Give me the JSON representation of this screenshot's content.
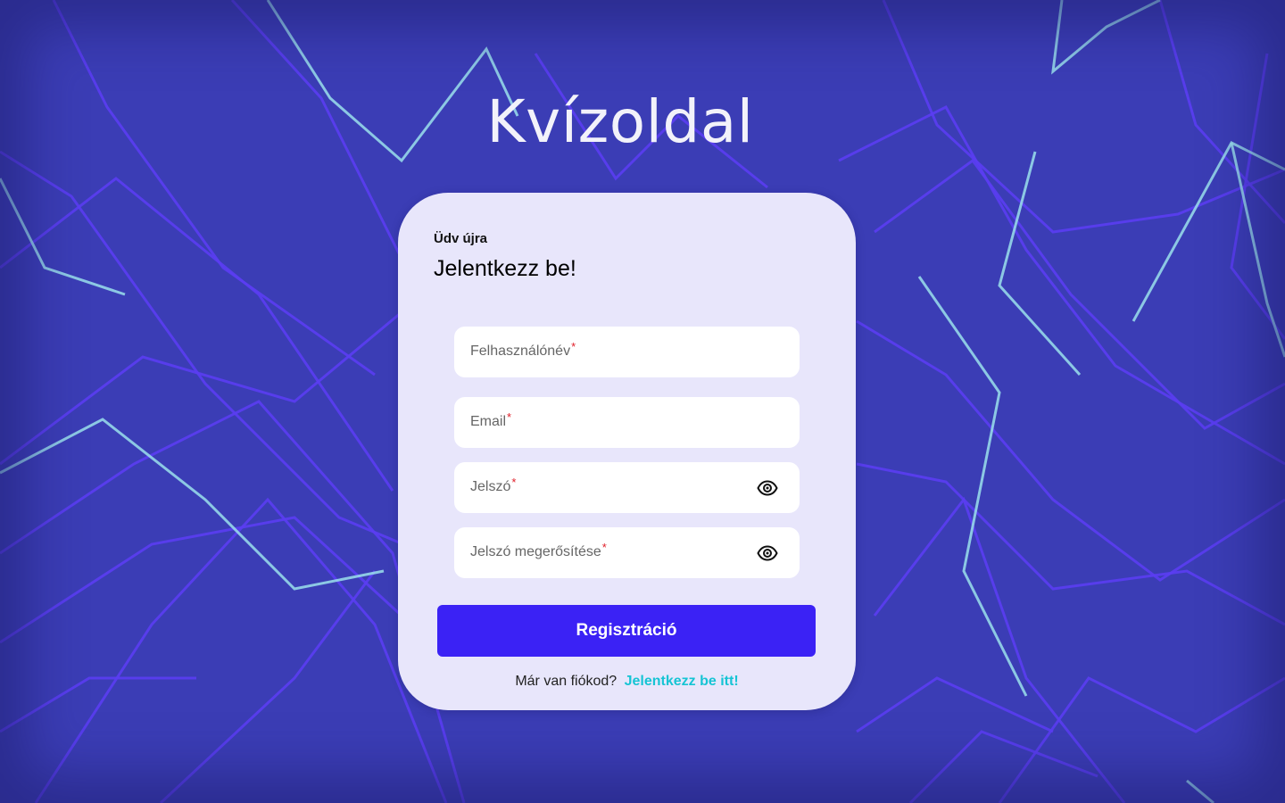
{
  "brand": {
    "title": "Kvízoldal"
  },
  "card": {
    "welcome": "Üdv újra",
    "heading": "Jelentkezz be!",
    "fields": [
      {
        "label": "Felhasználónév",
        "required_mark": "*",
        "value": "",
        "icon": null
      },
      {
        "label": "Email",
        "required_mark": "*",
        "value": "",
        "icon": null
      },
      {
        "label": "Jelszó",
        "required_mark": "*",
        "value": "",
        "icon": "eye-icon"
      },
      {
        "label": "Jelszó megerősítése",
        "required_mark": "*",
        "value": "",
        "icon": "eye-icon"
      }
    ],
    "submit_label": "Regisztráció",
    "footer_text": "Már van fiókod?",
    "footer_link": "Jelentkezz be itt!"
  },
  "colors": {
    "background": "#3b3db5",
    "card": "#e8e6fb",
    "primary_button": "#3b22f5",
    "link": "#16c4d4",
    "required": "#e0202a",
    "line_primary": "#5a3cf0",
    "line_glow": "#a8e6f0"
  }
}
